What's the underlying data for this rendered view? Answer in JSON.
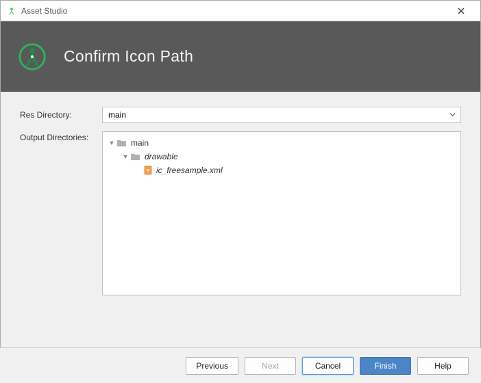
{
  "window": {
    "title": "Asset Studio"
  },
  "header": {
    "title": "Confirm Icon Path"
  },
  "form": {
    "res_dir_label": "Res Directory:",
    "res_dir_value": "main",
    "output_dir_label": "Output Directories:"
  },
  "tree": {
    "root": {
      "label": "main"
    },
    "child": {
      "label": "drawable"
    },
    "file": {
      "label": "ic_freesample.xml"
    }
  },
  "buttons": {
    "previous": "Previous",
    "next": "Next",
    "cancel": "Cancel",
    "finish": "Finish",
    "help": "Help"
  }
}
